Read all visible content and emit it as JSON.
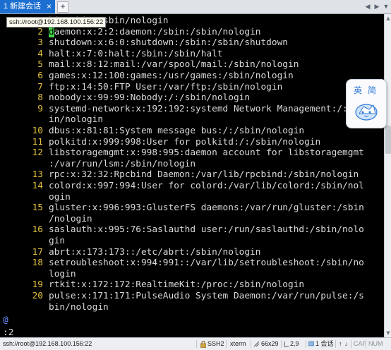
{
  "tabbar": {
    "active_tab_label": "1 新建会话",
    "tab_number_icon": "dot",
    "close_label": "×",
    "add_label": "+",
    "nav_left": "◀",
    "nav_right": "▶",
    "nav_menu": "▼"
  },
  "tooltip": {
    "text": "ssh://root@192.168.100.156:22"
  },
  "editor": {
    "lines": [
      {
        "n": "",
        "text": "bin:/bin:/sbin/nologin"
      },
      {
        "n": "2",
        "text": "daemon:x:2:2:daemon:/sbin:/sbin/nologin"
      },
      {
        "n": "3",
        "text": "shutdown:x:6:0:shutdown:/sbin:/sbin/shutdown"
      },
      {
        "n": "4",
        "text": "halt:x:7:0:halt:/sbin:/sbin/halt"
      },
      {
        "n": "5",
        "text": "mail:x:8:12:mail:/var/spool/mail:/sbin/nologin"
      },
      {
        "n": "6",
        "text": "games:x:12:100:games:/usr/games:/sbin/nologin"
      },
      {
        "n": "7",
        "text": "ftp:x:14:50:FTP User:/var/ftp:/sbin/nologin"
      },
      {
        "n": "8",
        "text": "nobody:x:99:99:Nobody:/:/sbin/nologin"
      },
      {
        "n": "9",
        "text": "systemd-network:x:192:192:systemd Network Management:/:/sb"
      },
      {
        "n": "",
        "text": "in/nologin"
      },
      {
        "n": "10",
        "text": "dbus:x:81:81:System message bus:/:/sbin/nologin"
      },
      {
        "n": "11",
        "text": "polkitd:x:999:998:User for polkitd:/:/sbin/nologin"
      },
      {
        "n": "12",
        "text": "libstoragemgmt:x:998:995:daemon account for libstoragemgmt"
      },
      {
        "n": "",
        "text": ":/var/run/lsm:/sbin/nologin"
      },
      {
        "n": "13",
        "text": "rpc:x:32:32:Rpcbind Daemon:/var/lib/rpcbind:/sbin/nologin"
      },
      {
        "n": "14",
        "text": "colord:x:997:994:User for colord:/var/lib/colord:/sbin/nol"
      },
      {
        "n": "",
        "text": "ogin"
      },
      {
        "n": "15",
        "text": "gluster:x:996:993:GlusterFS daemons:/var/run/gluster:/sbin"
      },
      {
        "n": "",
        "text": "/nologin"
      },
      {
        "n": "16",
        "text": "saslauth:x:995:76:Saslauthd user:/run/saslauthd:/sbin/nolo"
      },
      {
        "n": "",
        "text": "gin"
      },
      {
        "n": "17",
        "text": "abrt:x:173:173::/etc/abrt:/sbin/nologin"
      },
      {
        "n": "18",
        "text": "setroubleshoot:x:994:991::/var/lib/setroubleshoot:/sbin/no"
      },
      {
        "n": "",
        "text": "login"
      },
      {
        "n": "19",
        "text": "rtkit:x:172:172:RealtimeKit:/proc:/sbin/nologin"
      },
      {
        "n": "20",
        "text": "pulse:x:171:171:PulseAudio System Daemon:/var/run/pulse:/s"
      },
      {
        "n": "",
        "text": "bin/nologin"
      }
    ],
    "cursor_char": "d",
    "cursor_rest": "aemon:x:2:2:daemon:/sbin:/sbin/nologin",
    "eob_marker": "@",
    "command_line": ":2"
  },
  "widget": {
    "char_1": "英",
    "char_2": "简"
  },
  "statusbar": {
    "connection": "ssh://root@192.168.100.156:22",
    "protocol": "SSH2",
    "terminal_type": "xterm",
    "size": "66x29",
    "cursor_pos": "2,9",
    "sessions": "1 会话",
    "cap": "CAP",
    "num": "NUM"
  },
  "colors": {
    "line_number": "#e3c23c",
    "text": "#d9d9d9",
    "cursor": "#44d64a",
    "tab_active": "#1c6fd1",
    "eob": "#6a8cff"
  }
}
